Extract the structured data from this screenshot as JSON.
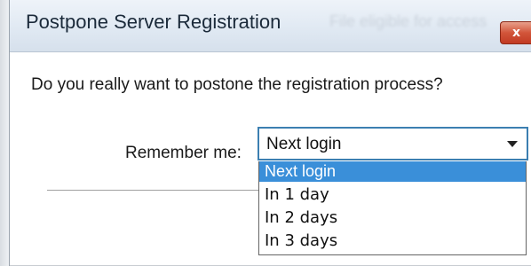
{
  "dialog": {
    "title": "Postpone Server Registration",
    "title_ghost": "File eligible for access",
    "close_glyph": "x"
  },
  "body": {
    "question": "Do you really want to postone the registration process?",
    "remember_label": "Remember me:"
  },
  "remember_select": {
    "selected": "Next login",
    "options": [
      "Next login",
      "In 1 day",
      "In 2 days",
      "In 3 days"
    ],
    "highlighted_index": 0
  },
  "colors": {
    "select_border": "#3c7fb1",
    "highlight": "#3a8fd9",
    "close_button": "#c23b23"
  }
}
